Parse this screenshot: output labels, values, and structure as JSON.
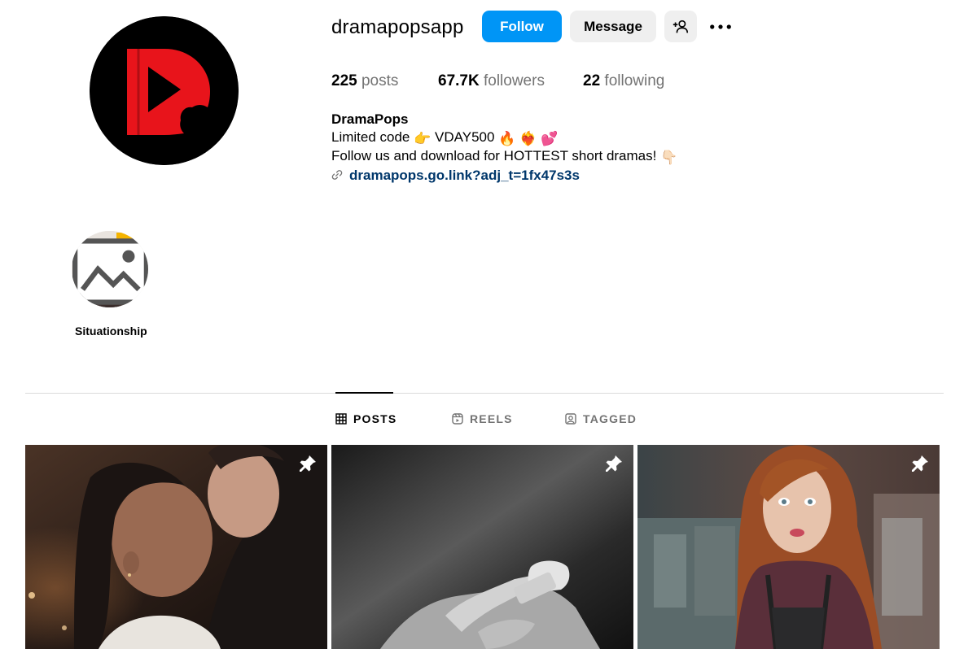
{
  "profile": {
    "username": "dramapopsapp",
    "avatar_icon": "dramapops-play-logo",
    "brand_color": "#e8141b",
    "follow_label": "Follow",
    "message_label": "Message",
    "add_user_icon": "person-plus-icon",
    "more_icon": "ellipsis-icon"
  },
  "stats": {
    "posts_count": "225",
    "posts_label": "posts",
    "followers_count": "67.7K",
    "followers_label": "followers",
    "following_count": "22",
    "following_label": "following"
  },
  "bio": {
    "name": "DramaPops",
    "line1_text": "Limited code",
    "line1_emoji_point": "👉",
    "line1_code": "VDAY500",
    "line1_emojis": [
      "🔥",
      "❤️‍🔥",
      "💕"
    ],
    "line2_text": "Follow us and download for HOTTEST short dramas!",
    "line2_emoji": "👇🏻",
    "link_icon": "link-icon",
    "link_text": "dramapops.go.link?adj_t=1fx47s3s"
  },
  "highlights": [
    {
      "label": "Situationship"
    }
  ],
  "tabs": [
    {
      "label": "POSTS",
      "icon": "grid-icon",
      "active": true
    },
    {
      "label": "REELS",
      "icon": "reels-icon",
      "active": false
    },
    {
      "label": "TAGGED",
      "icon": "tagged-icon",
      "active": false
    }
  ],
  "posts": [
    {
      "pinned": true,
      "scene": "couple-kissing"
    },
    {
      "pinned": true,
      "scene": "black-and-white-hands"
    },
    {
      "pinned": true,
      "scene": "woman-in-kitchen"
    }
  ],
  "colors": {
    "accent": "#0095f6",
    "button_gray": "#efefef",
    "secondary_text": "#737373",
    "link": "#00376b"
  }
}
